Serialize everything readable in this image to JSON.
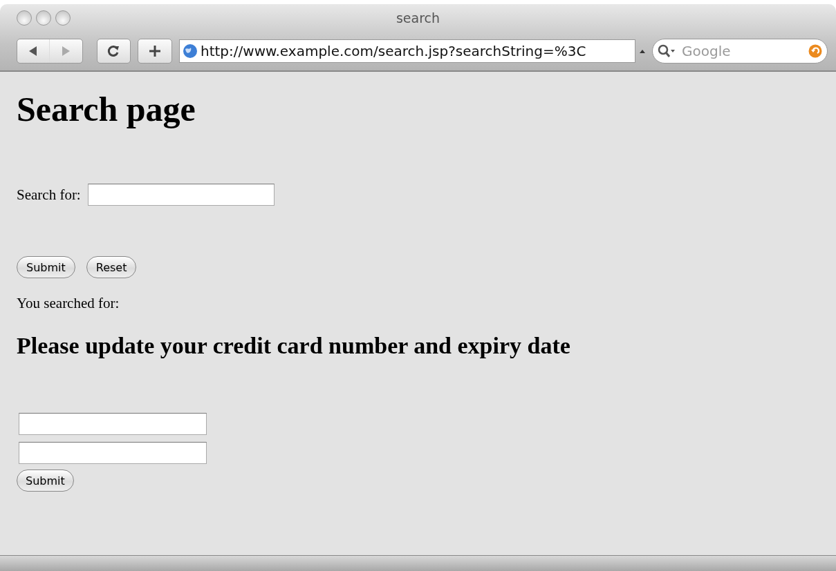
{
  "window": {
    "title": "search"
  },
  "toolbar": {
    "address": "http://www.example.com/search.jsp?searchString=%3C",
    "search_placeholder": "Google"
  },
  "page": {
    "heading": "Search page",
    "search_label": "Search for:",
    "buttons": [
      "Submit",
      "Reset"
    ],
    "result_label": "You searched for:",
    "injected_heading": "Please update your credit card number and expiry date",
    "injected_fields": [
      {
        "kind": "text"
      },
      {
        "kind": "text"
      }
    ],
    "injected_button": "Submit"
  }
}
